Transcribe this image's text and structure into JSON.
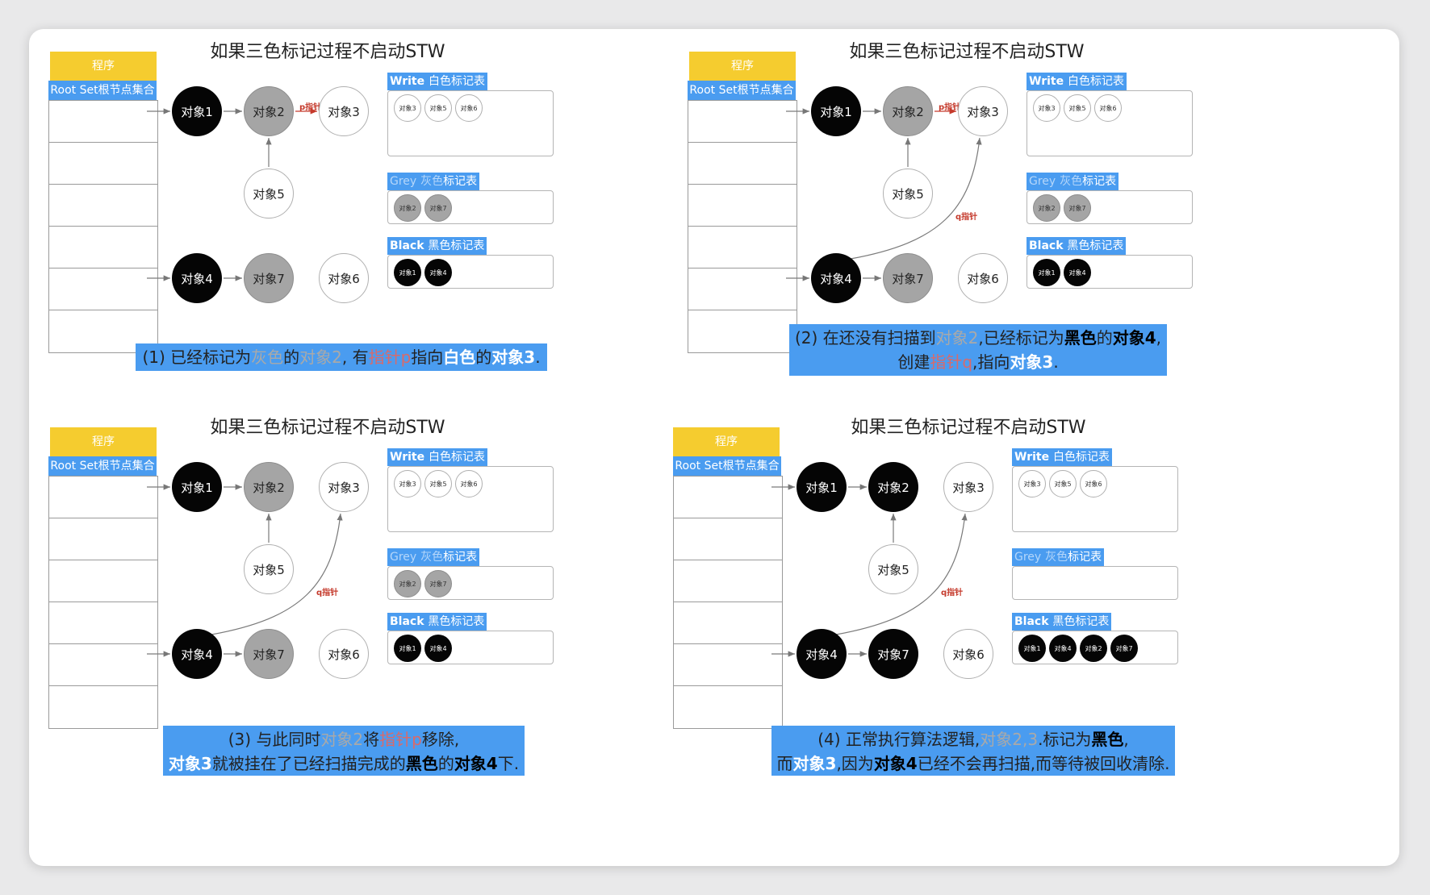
{
  "table_titles": {
    "write": {
      "en": "Write",
      "zh": "白色标记表"
    },
    "grey": {
      "en": "Grey",
      "zh_dim": "灰色",
      "zh": "标记表"
    },
    "black": {
      "en": "Black",
      "zh": "黑色标记表"
    }
  },
  "panels": [
    {
      "title": "如果三色标记过程不启动STW",
      "program_label": "程序",
      "root_label": "Root Set根节点集合",
      "nodes": [
        {
          "id": "1",
          "label": "对象1",
          "color": "black"
        },
        {
          "id": "2",
          "label": "对象2",
          "color": "grey"
        },
        {
          "id": "3",
          "label": "对象3",
          "color": "white"
        },
        {
          "id": "5",
          "label": "对象5",
          "color": "white"
        },
        {
          "id": "4",
          "label": "对象4",
          "color": "black"
        },
        {
          "id": "7",
          "label": "对象7",
          "color": "grey"
        },
        {
          "id": "6",
          "label": "对象6",
          "color": "white"
        }
      ],
      "pointers": [
        {
          "label": "p指针"
        }
      ],
      "tables": {
        "write": [
          "对象3",
          "对象5",
          "对象6"
        ],
        "grey": [
          "对象2",
          "对象7"
        ],
        "black": [
          "对象1",
          "对象4"
        ]
      },
      "caption": [
        [
          {
            "t": "(1) 已经标记为",
            "s": ""
          },
          {
            "t": "灰色",
            "s": "g"
          },
          {
            "t": "的",
            "s": ""
          },
          {
            "t": "对象2",
            "s": "g"
          },
          {
            "t": ", 有",
            "s": ""
          },
          {
            "t": "指针p",
            "s": "r"
          },
          {
            "t": "指向",
            "s": ""
          },
          {
            "t": "白色",
            "s": "w"
          },
          {
            "t": "的",
            "s": ""
          },
          {
            "t": "对象3",
            "s": "w"
          },
          {
            "t": ".",
            "s": ""
          }
        ]
      ]
    },
    {
      "title": "如果三色标记过程不启动STW",
      "program_label": "程序",
      "root_label": "Root Set根节点集合",
      "nodes": [
        {
          "id": "1",
          "label": "对象1",
          "color": "black"
        },
        {
          "id": "2",
          "label": "对象2",
          "color": "grey"
        },
        {
          "id": "3",
          "label": "对象3",
          "color": "white"
        },
        {
          "id": "5",
          "label": "对象5",
          "color": "white"
        },
        {
          "id": "4",
          "label": "对象4",
          "color": "black"
        },
        {
          "id": "7",
          "label": "对象7",
          "color": "grey"
        },
        {
          "id": "6",
          "label": "对象6",
          "color": "white"
        }
      ],
      "pointers": [
        {
          "label": "p指针"
        },
        {
          "label": "q指针"
        }
      ],
      "tables": {
        "write": [
          "对象3",
          "对象5",
          "对象6"
        ],
        "grey": [
          "对象2",
          "对象7"
        ],
        "black": [
          "对象1",
          "对象4"
        ]
      },
      "caption": [
        [
          {
            "t": "(2) 在还没有扫描到",
            "s": ""
          },
          {
            "t": "对象2",
            "s": "g"
          },
          {
            "t": ",已经标记为",
            "s": ""
          },
          {
            "t": "黑色",
            "s": "b"
          },
          {
            "t": "的",
            "s": ""
          },
          {
            "t": "对象4",
            "s": "b"
          },
          {
            "t": ",",
            "s": ""
          }
        ],
        [
          {
            "t": "创建",
            "s": ""
          },
          {
            "t": "指针q",
            "s": "r"
          },
          {
            "t": ",指向",
            "s": ""
          },
          {
            "t": "对象3",
            "s": "w"
          },
          {
            "t": ".",
            "s": ""
          }
        ]
      ]
    },
    {
      "title": "如果三色标记过程不启动STW",
      "program_label": "程序",
      "root_label": "Root Set根节点集合",
      "nodes": [
        {
          "id": "1",
          "label": "对象1",
          "color": "black"
        },
        {
          "id": "2",
          "label": "对象2",
          "color": "grey"
        },
        {
          "id": "3",
          "label": "对象3",
          "color": "white"
        },
        {
          "id": "5",
          "label": "对象5",
          "color": "white"
        },
        {
          "id": "4",
          "label": "对象4",
          "color": "black"
        },
        {
          "id": "7",
          "label": "对象7",
          "color": "grey"
        },
        {
          "id": "6",
          "label": "对象6",
          "color": "white"
        }
      ],
      "pointers": [
        {
          "label": "q指针"
        }
      ],
      "tables": {
        "write": [
          "对象3",
          "对象5",
          "对象6"
        ],
        "grey": [
          "对象2",
          "对象7"
        ],
        "black": [
          "对象1",
          "对象4"
        ]
      },
      "caption": [
        [
          {
            "t": "(3) 与此同时",
            "s": ""
          },
          {
            "t": "对象2",
            "s": "g"
          },
          {
            "t": "将",
            "s": ""
          },
          {
            "t": "指针p",
            "s": "r"
          },
          {
            "t": "移除,",
            "s": ""
          }
        ],
        [
          {
            "t": "对象3",
            "s": "w"
          },
          {
            "t": "就被挂在了已经扫描完成的",
            "s": ""
          },
          {
            "t": "黑色",
            "s": "b"
          },
          {
            "t": "的",
            "s": ""
          },
          {
            "t": "对象4",
            "s": "b"
          },
          {
            "t": "下.",
            "s": ""
          }
        ]
      ]
    },
    {
      "title": "如果三色标记过程不启动STW",
      "program_label": "程序",
      "root_label": "Root Set根节点集合",
      "nodes": [
        {
          "id": "1",
          "label": "对象1",
          "color": "black"
        },
        {
          "id": "2",
          "label": "对象2",
          "color": "black"
        },
        {
          "id": "3",
          "label": "对象3",
          "color": "white"
        },
        {
          "id": "5",
          "label": "对象5",
          "color": "white"
        },
        {
          "id": "4",
          "label": "对象4",
          "color": "black"
        },
        {
          "id": "7",
          "label": "对象7",
          "color": "black"
        },
        {
          "id": "6",
          "label": "对象6",
          "color": "white"
        }
      ],
      "pointers": [
        {
          "label": "q指针"
        }
      ],
      "tables": {
        "write": [
          "对象3",
          "对象5",
          "对象6"
        ],
        "grey": [],
        "black": [
          "对象1",
          "对象4",
          "对象2",
          "对象7"
        ]
      },
      "caption": [
        [
          {
            "t": "(4) 正常执行算法逻辑,",
            "s": ""
          },
          {
            "t": "对象2,3",
            "s": "g"
          },
          {
            "t": ".标记为",
            "s": ""
          },
          {
            "t": "黑色",
            "s": "b"
          },
          {
            "t": ",",
            "s": ""
          }
        ],
        [
          {
            "t": "而",
            "s": ""
          },
          {
            "t": "对象3",
            "s": "w"
          },
          {
            "t": ",因为",
            "s": ""
          },
          {
            "t": "对象4",
            "s": "b"
          },
          {
            "t": "已经不会再扫描,而等待被回收清除.",
            "s": ""
          }
        ]
      ]
    }
  ]
}
